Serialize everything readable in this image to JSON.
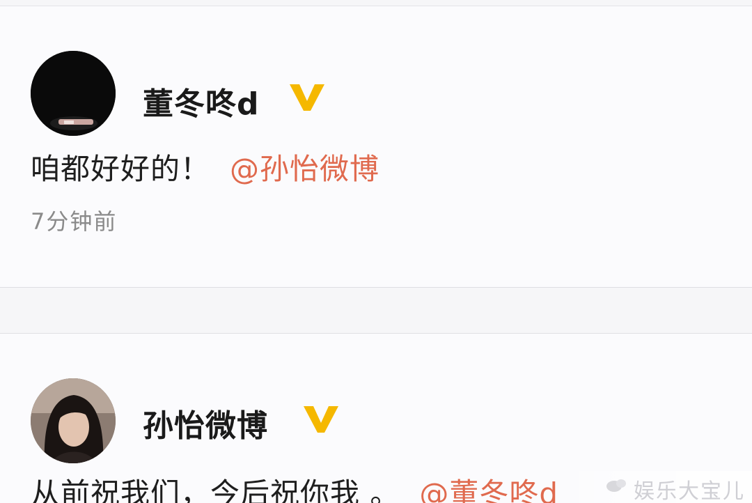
{
  "posts": [
    {
      "username": "董冬咚d",
      "text": "咱都好好的！",
      "mention": "@孙怡微博",
      "timestamp": "7分钟前"
    },
    {
      "username": "孙怡微博",
      "text": "从前祝我们，今后祝你我 。",
      "mention": "@董冬咚d"
    }
  ],
  "watermark": {
    "text": "娱乐大宝儿"
  },
  "colors": {
    "mention": "#e06a4e",
    "verified_badge": "#f5b800",
    "background": "#f6f6f8"
  },
  "icons": {
    "verified": "verified-v-icon"
  }
}
